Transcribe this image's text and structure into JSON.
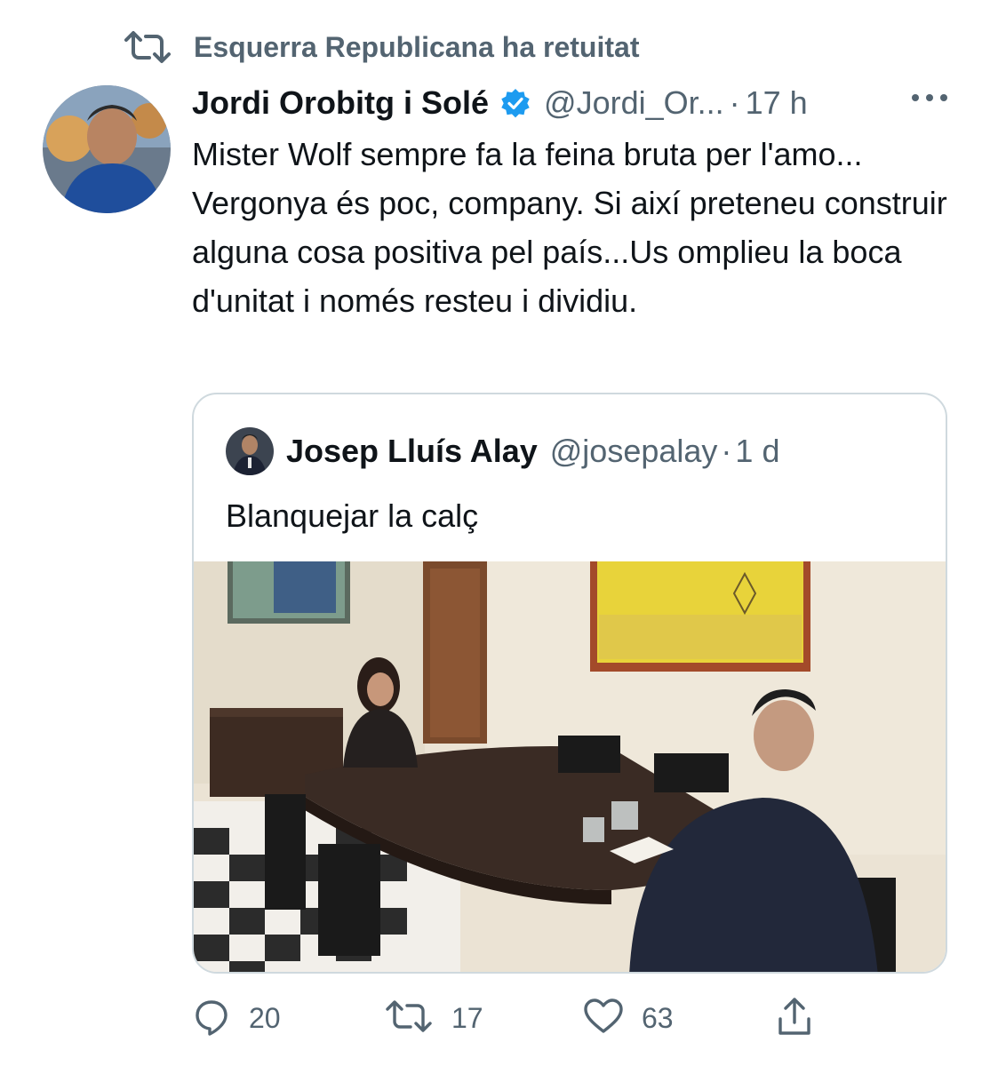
{
  "retweet": {
    "icon": "retweet-icon",
    "text": "Esquerra Republicana ha retuitat"
  },
  "tweet": {
    "author_name": "Jordi Orobitg i Solé",
    "verified": true,
    "handle": "@Jordi_Or...",
    "dot": "·",
    "time": "17 h",
    "text": "Mister Wolf sempre fa la feina bruta per l'amo... Vergonya és poc, company.  Si així preteneu construir alguna cosa positiva pel país...Us omplieu la boca d'unitat i només resteu i dividiu."
  },
  "quote": {
    "author_name": "Josep Lluís Alay",
    "handle": "@josepalay",
    "dot": "·",
    "time": "1 d",
    "text": "Blanquejar la calç"
  },
  "actions": {
    "reply_count": "20",
    "retweet_count": "17",
    "like_count": "63"
  },
  "colors": {
    "verified": "#1d9bf0",
    "muted": "#536471",
    "text": "#0f1419",
    "border": "#cfd9de"
  }
}
